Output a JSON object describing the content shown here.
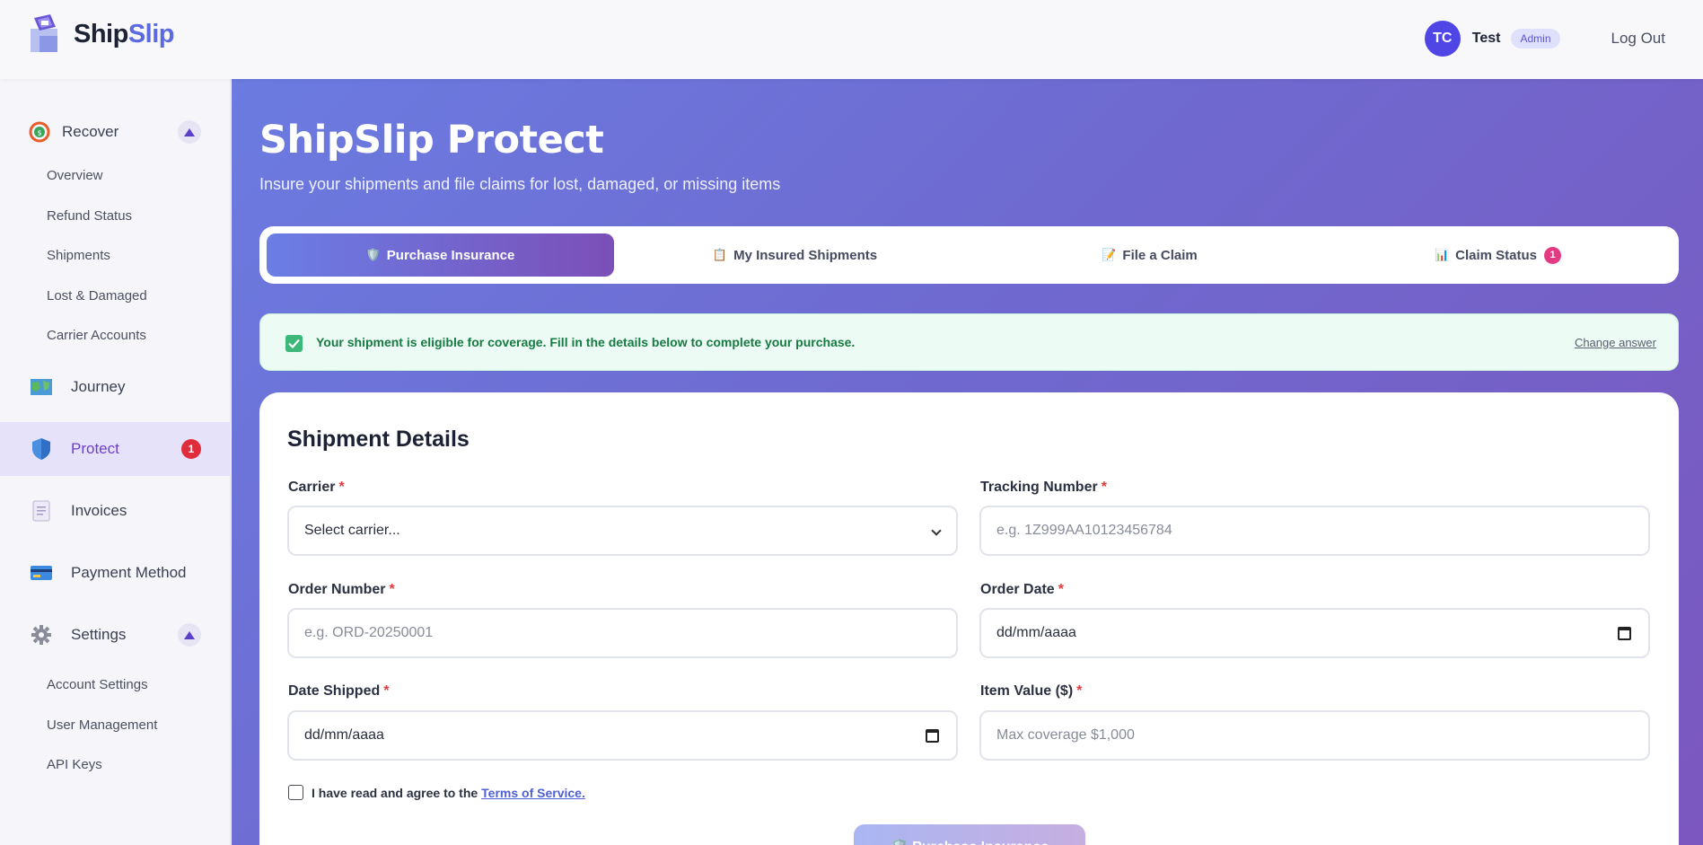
{
  "header": {
    "logo_part1": "Ship",
    "logo_part2": "Slip",
    "avatar_initials": "TC",
    "username": "Test",
    "role": "Admin",
    "logout": "Log Out"
  },
  "sidebar": {
    "recover": "Recover",
    "recover_items": [
      "Overview",
      "Refund Status",
      "Shipments",
      "Lost & Damaged",
      "Carrier Accounts"
    ],
    "journey": "Journey",
    "protect": "Protect",
    "protect_badge": "1",
    "invoices": "Invoices",
    "payment": "Payment Method",
    "settings": "Settings",
    "settings_items": [
      "Account Settings",
      "User Management",
      "API Keys"
    ]
  },
  "page": {
    "title": "ShipSlip Protect",
    "subtitle": "Insure your shipments and file claims for lost, damaged, or missing items"
  },
  "tabs": [
    {
      "label": "Purchase Insurance",
      "icon": "🛡️"
    },
    {
      "label": "My Insured Shipments",
      "icon": "📋"
    },
    {
      "label": "File a Claim",
      "icon": "📝"
    },
    {
      "label": "Claim Status",
      "icon": "📊",
      "count": "1"
    }
  ],
  "notice": {
    "message": "Your shipment is eligible for coverage. Fill in the details below to complete your purchase.",
    "change": "Change answer"
  },
  "form": {
    "title": "Shipment Details",
    "carrier_label": "Carrier",
    "carrier_value": "Select carrier...",
    "tracking_label": "Tracking Number",
    "tracking_placeholder": "e.g. 1Z999AA10123456784",
    "order_label": "Order Number",
    "order_placeholder": "e.g. ORD-20250001",
    "order_date_label": "Order Date",
    "order_date_value": "dd/mm/aaaa",
    "shipped_label": "Date Shipped",
    "shipped_value": "dd/mm/aaaa",
    "value_label": "Item Value ($)",
    "value_placeholder": "Max coverage $1,000",
    "required_mark": "*",
    "terms_text": "I have read and agree to the",
    "terms_link": "Terms of Service.",
    "submit": "🛡️ Purchase Insurance"
  }
}
